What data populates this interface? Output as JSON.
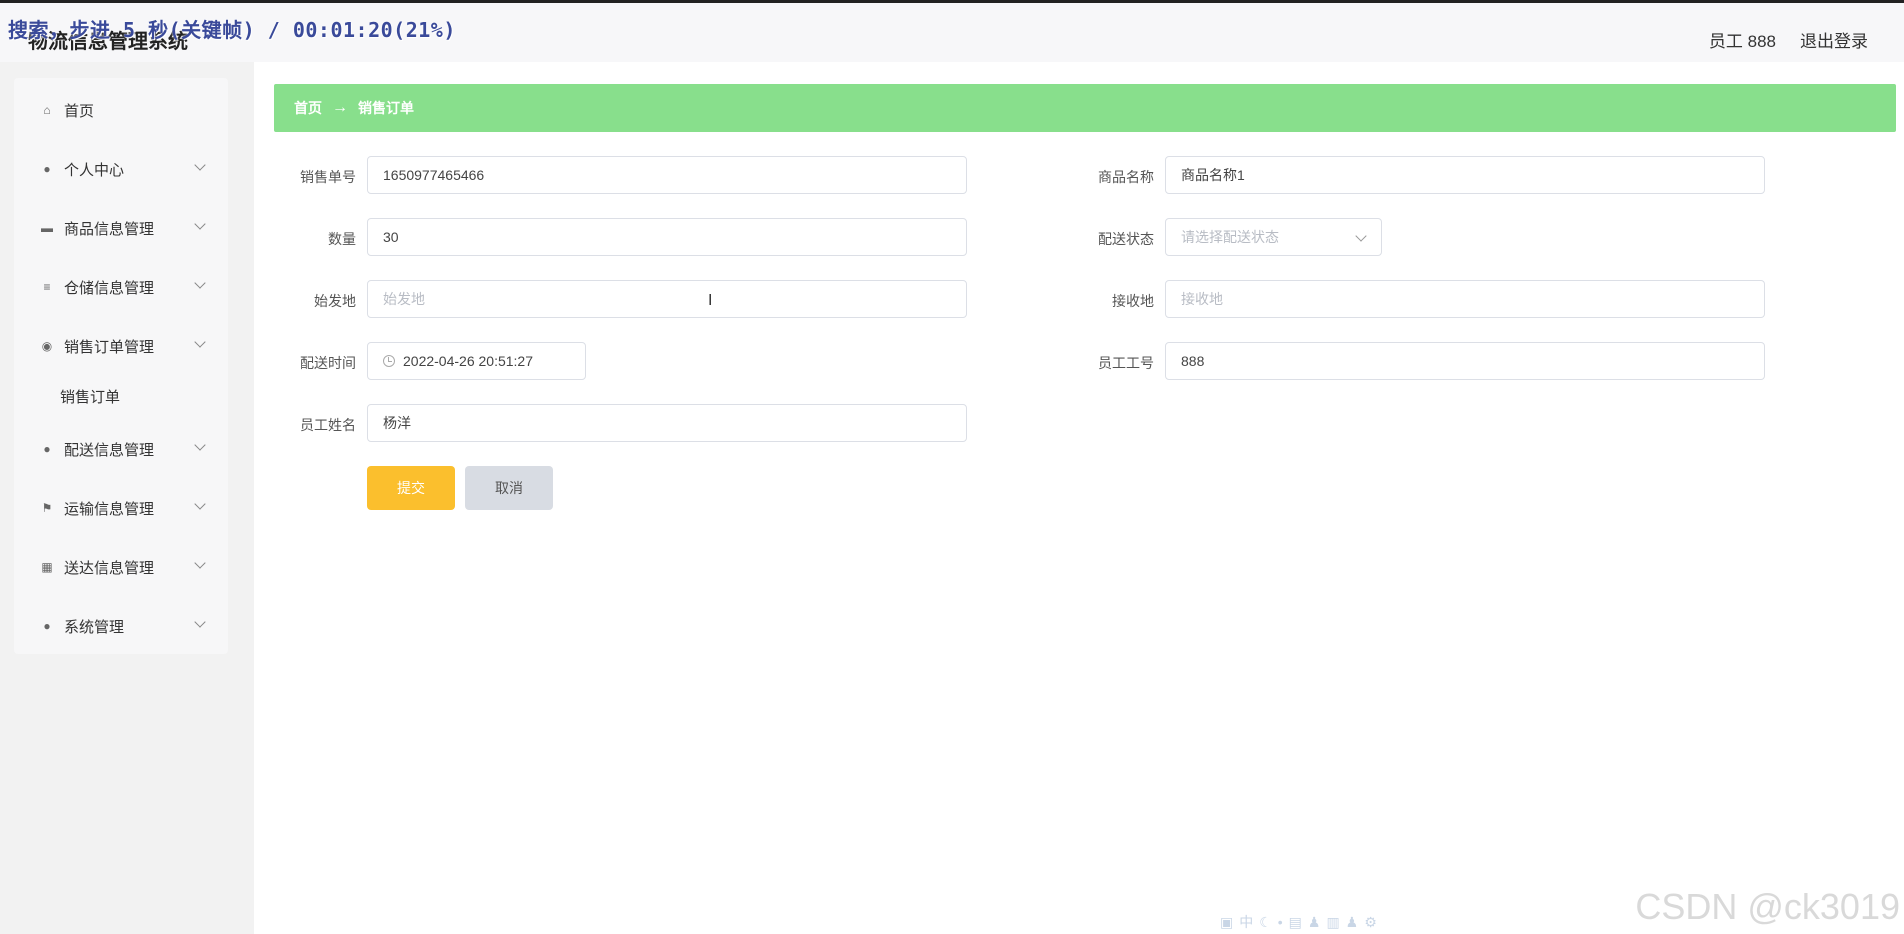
{
  "overlay": {
    "text": "搜索，步进 5 秒(关键帧) / 00:01:20(21%)"
  },
  "header": {
    "title": "物流信息管理系统",
    "user": "员工 888",
    "logout": "退出登录"
  },
  "sidebar": {
    "items": [
      {
        "label": "首页",
        "icon": "home-icon"
      },
      {
        "label": "个人中心",
        "icon": "user-icon"
      },
      {
        "label": "商品信息管理",
        "icon": "comment-icon"
      },
      {
        "label": "仓储信息管理",
        "icon": "sliders-icon"
      },
      {
        "label": "销售订单管理",
        "icon": "location-icon"
      },
      {
        "label": "配送信息管理",
        "icon": "user-icon"
      },
      {
        "label": "运输信息管理",
        "icon": "flag-icon"
      },
      {
        "label": "送达信息管理",
        "icon": "grid-icon"
      },
      {
        "label": "系统管理",
        "icon": "user-icon"
      }
    ],
    "submenu": {
      "label": "销售订单"
    }
  },
  "breadcrumb": {
    "home": "首页",
    "arrow": "→",
    "current": "销售订单"
  },
  "form": {
    "order_no": {
      "label": "销售单号",
      "value": "1650977465466"
    },
    "product_name": {
      "label": "商品名称",
      "value": "商品名称1"
    },
    "quantity": {
      "label": "数量",
      "value": "30"
    },
    "delivery_status": {
      "label": "配送状态",
      "placeholder": "请选择配送状态"
    },
    "origin": {
      "label": "始发地",
      "placeholder": "始发地"
    },
    "destination": {
      "label": "接收地",
      "placeholder": "接收地"
    },
    "delivery_time": {
      "label": "配送时间",
      "value": "2022-04-26 20:51:27"
    },
    "employee_no": {
      "label": "员工工号",
      "value": "888"
    },
    "employee_name": {
      "label": "员工姓名",
      "value": "杨洋"
    },
    "submit": "提交",
    "cancel": "取消"
  },
  "watermark": "CSDN @ck3019",
  "colors": {
    "breadcrumb": "#88df8c",
    "submit": "#fbbf2d",
    "cancel": "#d8dce3"
  }
}
